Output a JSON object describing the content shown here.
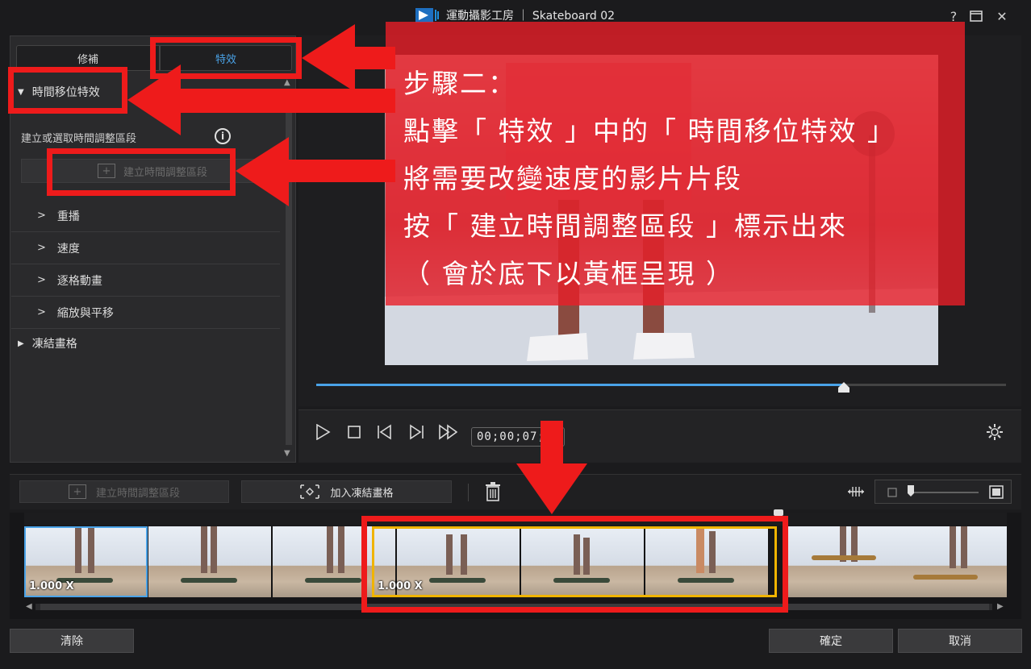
{
  "window": {
    "title": "運動攝影工房 ｜ Skateboard 02",
    "help": "?",
    "restore": "❐",
    "close": "✕"
  },
  "tabs": {
    "fix": "修補",
    "effects": "特效"
  },
  "left_panel": {
    "section_time_shift": "時間移位特效",
    "create_select_label": "建立或選取時間調整區段",
    "info": "i",
    "create_button": "建立時間調整區段",
    "items": [
      "重播",
      "速度",
      "逐格動畫",
      "縮放與平移"
    ],
    "section_freeze": "凍結畫格"
  },
  "player": {
    "timecode": "00;00;07;20",
    "progress": 0.765
  },
  "annotation": {
    "lines": [
      "步驟二：",
      "點擊「 特效 」中的「 時間移位特效 」",
      "將需要改變速度的影片片段",
      "按「 建立時間調整區段 」標示出來",
      "（ 會於底下以黃框呈現 ）"
    ]
  },
  "timeline_toolbar": {
    "create_segment": "建立時間調整區段",
    "add_freeze": "加入凍結畫格"
  },
  "timeline": {
    "speed_blue": "1.000 X",
    "speed_yellow": "1.000 X"
  },
  "footer": {
    "clear": "清除",
    "ok": "確定",
    "cancel": "取消"
  },
  "colors": {
    "accent": "#4aa3e8",
    "annotation_red": "#ee1b1b",
    "selection_yellow": "#f0b400"
  }
}
